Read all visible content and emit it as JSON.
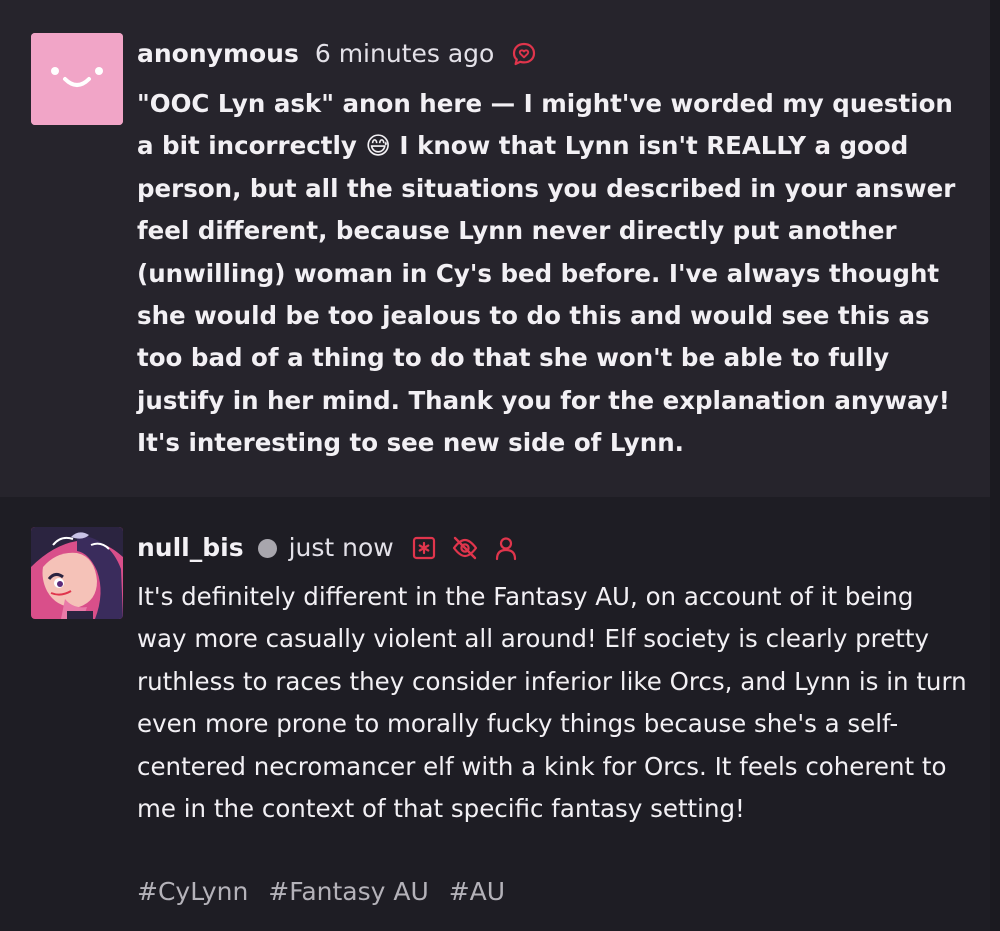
{
  "ask": {
    "author": "anonymous",
    "time": "6 minutes ago",
    "icon": "ask-bubble-icon",
    "avatar_color": "#f1a5c7",
    "body": "\"OOC Lyn ask\" anon here — I might've worded my question a bit incorrectly 😅 I know that Lynn isn't REALLY a good person, but all the situations you described in your answer feel different, because Lynn never directly put another (unwilling) woman in Cy's bed before. I've always thought she would be too jealous to do this and would see this as too bad of a thing to do that she won't be able to fully justify in her mind. Thank you for the explanation anyway! It's interesting to see new side of Lynn."
  },
  "answer": {
    "author": "null_bis",
    "time": "just now",
    "status": "online",
    "icons": [
      "asterisk-box-icon",
      "eye-slash-icon",
      "person-icon"
    ],
    "body": "It's definitely different in the Fantasy AU, on account of it being way more casually violent all around! Elf society is clearly pretty ruthless to races they consider inferior like Orcs, and Lynn is in turn even more prone to morally fucky things because she's a self-centered necromancer elf with a kink for Orcs. It feels coherent to me in the context of that specific fantasy setting!",
    "tags": [
      "#CyLynn",
      "#Fantasy AU",
      "#AU"
    ]
  },
  "colors": {
    "accent": "#e0354c",
    "ask_background": "#26242c",
    "answer_background": "#1e1d24",
    "tag_text": "#b4b2b9"
  }
}
